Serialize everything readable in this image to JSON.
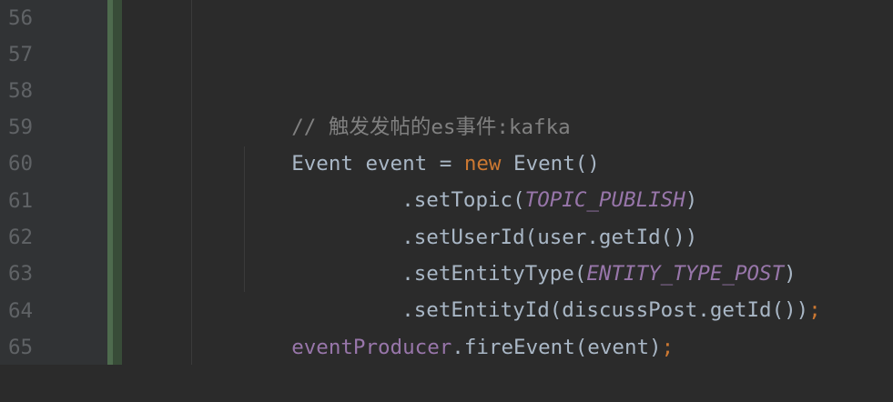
{
  "gutter": {
    "line_numbers": [
      "56",
      "57",
      "58",
      "59",
      "60",
      "61",
      "62",
      "63",
      "64",
      "65"
    ]
  },
  "code": {
    "line58_comment": "// 触发发帖的es事件:kafka",
    "line59_type": "Event",
    "line59_var": " event = ",
    "line59_new": "new",
    "line59_ctor": " Event()",
    "line60_method": ".setTopic(",
    "line60_const": "TOPIC_PUBLISH",
    "line60_close": ")",
    "line61_text": ".setUserId(user.getId())",
    "line62_method": ".setEntityType(",
    "line62_const": "ENTITY_TYPE_POST",
    "line62_close": ")",
    "line63_text": ".setEntityId(discussPost.getId())",
    "line63_semi": ";",
    "line64_field": "eventProducer",
    "line64_call": ".fireEvent(event)",
    "line64_semi": ";"
  },
  "colors": {
    "background": "#2b2b2b",
    "gutter": "#313335",
    "line_number": "#606366",
    "default_text": "#a9b7c6",
    "comment": "#808080",
    "keyword": "#cc7832",
    "constant": "#9876aa",
    "change_marker": "#4e6b4e"
  }
}
